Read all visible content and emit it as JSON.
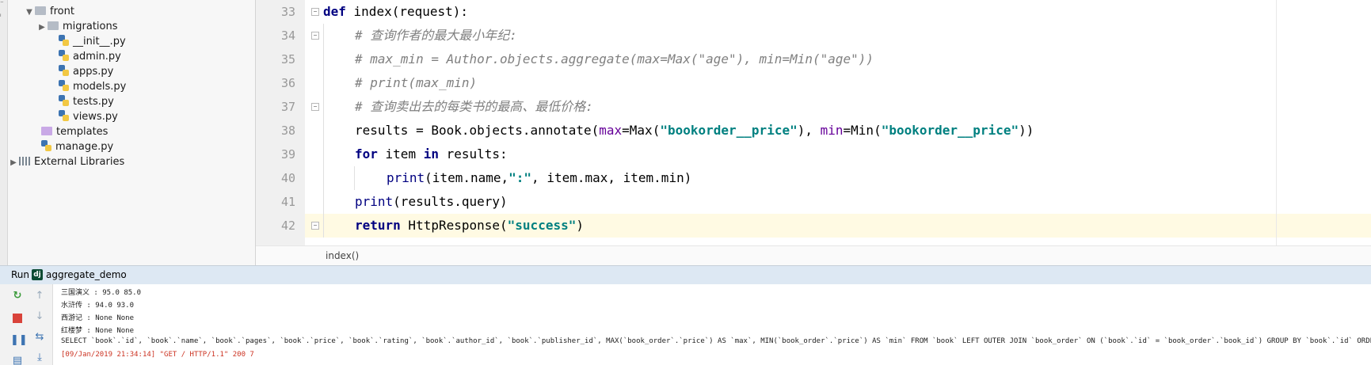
{
  "project_tree": {
    "items": [
      {
        "label": "front",
        "kind": "folder"
      },
      {
        "label": "migrations",
        "kind": "folder"
      },
      {
        "label": "__init__.py",
        "kind": "py"
      },
      {
        "label": "admin.py",
        "kind": "py"
      },
      {
        "label": "apps.py",
        "kind": "py"
      },
      {
        "label": "models.py",
        "kind": "py"
      },
      {
        "label": "tests.py",
        "kind": "py"
      },
      {
        "label": "views.py",
        "kind": "py"
      },
      {
        "label": "templates",
        "kind": "folder"
      },
      {
        "label": "manage.py",
        "kind": "py"
      },
      {
        "label": "External Libraries",
        "kind": "library"
      }
    ]
  },
  "editor": {
    "line_numbers": [
      "33",
      "34",
      "35",
      "36",
      "37",
      "38",
      "39",
      "40",
      "41",
      "42"
    ],
    "breadcrumb": "index()",
    "lines": {
      "l33": {
        "kw": "def",
        "rest": " index(request):"
      },
      "l34": {
        "comment": "# 查询作者的最大最小年纪:"
      },
      "l35": {
        "comment": "# max_min = Author.objects.aggregate(max=Max(\"age\"), min=Min(\"age\"))"
      },
      "l36": {
        "comment": "# print(max_min)"
      },
      "l37": {
        "comment": "# 查询卖出去的每类书的最高、最低价格:"
      },
      "l38": {
        "a": "results = Book.objects.annotate(",
        "k1": "max",
        "b": "=Max(",
        "s1": "\"bookorder__price\"",
        "c": "), ",
        "k2": "min",
        "d": "=Min(",
        "s2": "\"bookorder__price\"",
        "e": "))"
      },
      "l39": {
        "kw1": "for",
        "a": " item ",
        "kw2": "in",
        "b": " results:"
      },
      "l40": {
        "fn": "print",
        "a": "(item.name,",
        "s": "\":\"",
        "b": ", item.max, item.min)"
      },
      "l41": {
        "fn": "print",
        "a": "(results.query)"
      },
      "l42": {
        "kw": "return",
        "a": " HttpResponse(",
        "s": "\"success\"",
        "b": ")"
      }
    }
  },
  "run_panel": {
    "label": "Run",
    "config_icon_text": "dj",
    "config_name": "aggregate_demo",
    "console_lines": [
      "三国演义 : 95.0 85.0",
      "水浒传 : 94.0 93.0",
      "西游记 : None None",
      "红楼梦 : None None",
      "SELECT `book`.`id`, `book`.`name`, `book`.`pages`, `book`.`price`, `book`.`rating`, `book`.`author_id`, `book`.`publisher_id`, MAX(`book_order`.`price`) AS `max`, MIN(`book_order`.`price`) AS `min` FROM `book` LEFT OUTER JOIN `book_order` ON (`book`.`id` = `book_order`.`book_id`) GROUP BY `book`.`id` ORDER BY NULL",
      "[09/Jan/2019 21:34:14] \"GET / HTTP/1.1\" 200 7"
    ]
  }
}
